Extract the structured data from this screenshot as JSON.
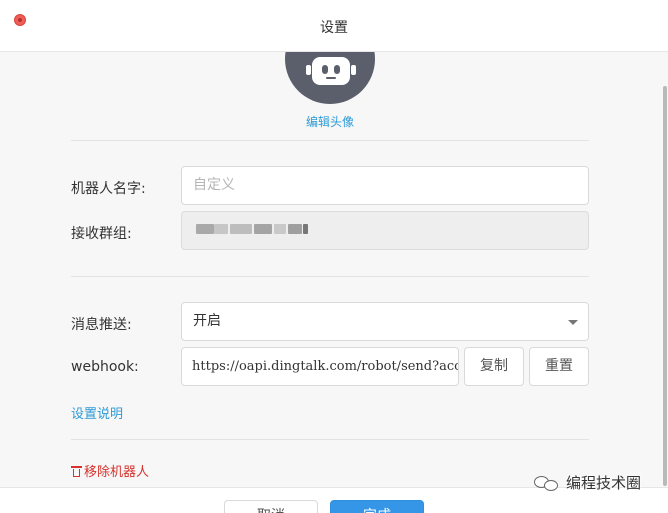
{
  "window": {
    "title": "设置"
  },
  "avatar": {
    "edit_label": "编辑头像"
  },
  "form": {
    "name_label": "机器人名字:",
    "name_placeholder": "自定义",
    "group_label": "接收群组:",
    "push_label": "消息推送:",
    "push_value": "开启",
    "webhook_label": "webhook:",
    "webhook_value": "https://oapi.dingtalk.com/robot/send?access_t",
    "copy_label": "复制",
    "reset_label": "重置",
    "settings_help": "设置说明",
    "remove_label": "移除机器人"
  },
  "footer": {
    "cancel_label": "取消",
    "done_label": "完成"
  },
  "watermark": {
    "text": "编程技术圈"
  },
  "colors": {
    "accent": "#3596e8",
    "link": "#2e9bd6",
    "danger": "#d7322d"
  },
  "icons": [
    "close-icon",
    "robot-avatar-icon",
    "chevron-down-icon",
    "trash-icon",
    "wechat-icon"
  ]
}
